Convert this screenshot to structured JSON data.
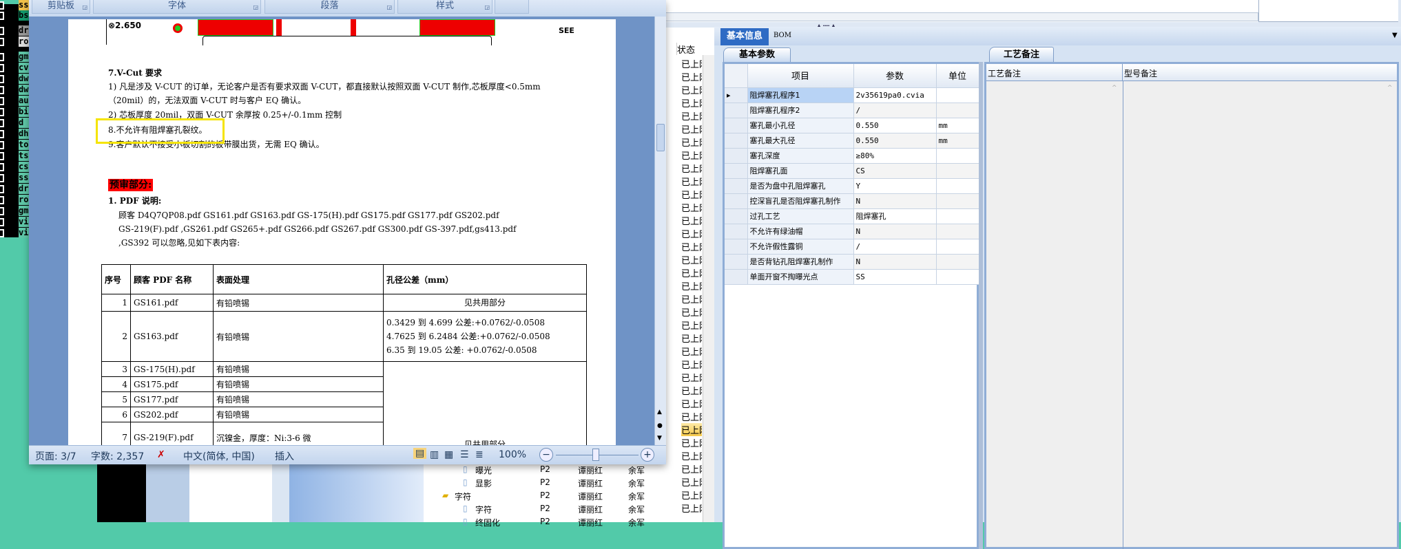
{
  "left_strip": {
    "labels": [
      "ss",
      "bs",
      "dr",
      "ro",
      "gm",
      "cv",
      "dw",
      "dw",
      "au",
      "bi",
      "d",
      "dh",
      "to",
      "ts",
      "cs",
      "ss",
      "dr",
      "ro",
      "gm",
      "vi",
      "vi"
    ]
  },
  "word": {
    "ribbon_groups": [
      "剪贴板",
      "字体",
      "段落",
      "样式"
    ],
    "doc": {
      "drawing_label": "⊗2.650",
      "drawing_label2": "SEE",
      "heading7": "7.V-Cut 要求",
      "line1": "1) 凡是涉及 V-CUT 的订单，无论客户是否有要求双面 V-CUT，都直接默认按照双面 V-CUT 制作,芯板厚度<0.5mm",
      "line1b": "（20mil）的，无法双面 V-CUT 时与客户 EQ 确认。",
      "line2": "2) 芯板厚度 20mil，双面 V-CUT 余厚按 0.25+/-0.1mm 控制",
      "line8": "8.不允许有阻焊塞孔裂纹。",
      "line9": "9.客户默认不接受小板切割的板带膜出货，无需 EQ 确认。",
      "preview_title": "预审部分:",
      "pdf_heading": "1.  PDF 说明:",
      "pdf_line1": "顾客 D4Q7QP08.pdf GS161.pdf GS163.pdf GS-175(H).pdf GS175.pdf GS177.pdf GS202.pdf",
      "pdf_line2": "GS-219(F).pdf ,GS261.pdf GS265+.pdf GS266.pdf GS267.pdf GS300.pdf GS-397.pdf,gs413.pdf",
      "pdf_line3": ",GS392 可以忽略,见如下表内容:",
      "table": {
        "headers": [
          "序号",
          "顾客 PDF 名称",
          "表面处理",
          "孔径公差（mm）"
        ],
        "rows": [
          {
            "no": "1",
            "name": "GS161.pdf",
            "surface": "有铅喷锡",
            "tol": "见共用部分"
          },
          {
            "no": "2",
            "name": "GS163.pdf",
            "surface": "有铅喷锡",
            "tol": "0.3429 到 4.699 公差:+0.0762/-0.0508\n4.7625 到 6.2484 公差:+0.0762/-0.0508\n6.35  到 19.05 公差: +0.0762/-0.0508"
          },
          {
            "no": "3",
            "name": "GS-175(H).pdf",
            "surface": "有铅喷锡",
            "tol": ""
          },
          {
            "no": "4",
            "name": "GS175.pdf",
            "surface": "有铅喷锡",
            "tol": ""
          },
          {
            "no": "5",
            "name": "GS177.pdf",
            "surface": "有铅喷锡",
            "tol": ""
          },
          {
            "no": "6",
            "name": "GS202.pdf",
            "surface": "有铅喷锡",
            "tol": ""
          },
          {
            "no": "7",
            "name": "GS-219(F).pdf",
            "surface": "沉镍金，厚度：Ni:3-6 微",
            "tol": "见共用部分"
          }
        ]
      }
    },
    "status_bar": {
      "page": "页面: 3/7",
      "words": "字数: 2,357",
      "language": "中文(简体, 中国)",
      "mode": "插入",
      "zoom": "100%",
      "zoom_level_percent": 100
    }
  },
  "status_column": {
    "header": "状态",
    "rows": [
      "已上网",
      "已上网",
      "已上网",
      "已上网",
      "已上网",
      "已上网",
      "已上网",
      "已上网",
      "已上网",
      "已上网",
      "已上网",
      "已上网",
      "已上网",
      "已上网",
      "已上网",
      "已上网",
      "已上网",
      "已上网",
      "已上网",
      "已上网",
      "已上网",
      "已上网",
      "已上网",
      "已上网",
      "已上网",
      "已上网",
      "已上网",
      "已上网",
      "已上网",
      "已上网",
      "已上网",
      "已上网",
      "已上网",
      "已上网",
      "已上网"
    ],
    "selected_index": 28
  },
  "tree": {
    "rows": [
      {
        "name": "曝光",
        "type": "file",
        "level": "P2",
        "owner": "谭丽红",
        "reviewer": "余军"
      },
      {
        "name": "显影",
        "type": "file",
        "level": "P2",
        "owner": "谭丽红",
        "reviewer": "余军"
      },
      {
        "name": "字符",
        "type": "folder",
        "level": "P2",
        "owner": "谭丽红",
        "reviewer": "余军"
      },
      {
        "name": "字符",
        "type": "file",
        "level": "P2",
        "owner": "谭丽红",
        "reviewer": "余军"
      },
      {
        "name": "终固化",
        "type": "file",
        "level": "P2",
        "owner": "谭丽红",
        "reviewer": "余军"
      }
    ]
  },
  "right_panel": {
    "tabs": [
      "基本信息",
      "BOM"
    ],
    "subtab": "基本参数",
    "grid": {
      "headers": [
        "项目",
        "参数",
        "单位"
      ],
      "rows": [
        [
          "阻焊塞孔程序1",
          "2v35619pa0.cvia",
          ""
        ],
        [
          "阻焊塞孔程序2",
          "/",
          ""
        ],
        [
          "塞孔最小孔径",
          "0.550",
          "mm"
        ],
        [
          "塞孔最大孔径",
          "0.550",
          "mm"
        ],
        [
          "塞孔深度",
          "≥80%",
          ""
        ],
        [
          "阻焊塞孔面",
          "CS",
          ""
        ],
        [
          "是否为盘中孔阻焊塞孔",
          "Y",
          ""
        ],
        [
          "控深盲孔是否阻焊塞孔制作",
          "N",
          ""
        ],
        [
          "过孔工艺",
          "阻焊塞孔",
          ""
        ],
        [
          "不允许有绿油帽",
          "N",
          ""
        ],
        [
          "不允许假性露铜",
          "/",
          ""
        ],
        [
          "是否背钻孔阻焊塞孔制作",
          "N",
          ""
        ],
        [
          "单面开窗不掏曝光点",
          "SS",
          ""
        ]
      ]
    },
    "notes_tab": "工艺备注",
    "notes_headers": [
      "工艺备注",
      "型号备注"
    ]
  },
  "colors": {
    "highlight_box": "#f5e400",
    "red_highlight": "#ff0000",
    "selected_tab": "#2e6bc4",
    "background": "#52caa9"
  }
}
